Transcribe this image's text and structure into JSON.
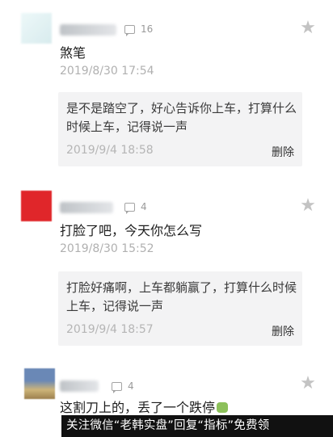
{
  "comments": [
    {
      "reply_count": "16",
      "text": "煞笔",
      "time": "2019/8/30 17:54",
      "reply": {
        "text": "是不是踏空了，好心告诉你上车，打算什么时候上车，记得说一声",
        "time": "2019/9/4 18:58",
        "delete_label": "删除"
      }
    },
    {
      "reply_count": "4",
      "text": "打脸了吧，今天你怎么写",
      "time": "2019/8/30 15:52",
      "reply": {
        "text": "打脸好痛啊，上车都躺赢了，打算什么时候上车，记得说一声",
        "time": "2019/9/4 18:57",
        "delete_label": "删除"
      }
    },
    {
      "reply_count": "4",
      "text": "这割刀上的，丢了一个跌停"
    }
  ],
  "watermark": "关注微信“老韩实盘”回复“指标”免费领",
  "icons": {
    "reply": "comment-bubble-icon",
    "favorite": "star-icon"
  },
  "colors": {
    "avatar_2": "#e0262a",
    "reply_box": "#f3f3f4",
    "muted_text": "#b0b0b0"
  }
}
